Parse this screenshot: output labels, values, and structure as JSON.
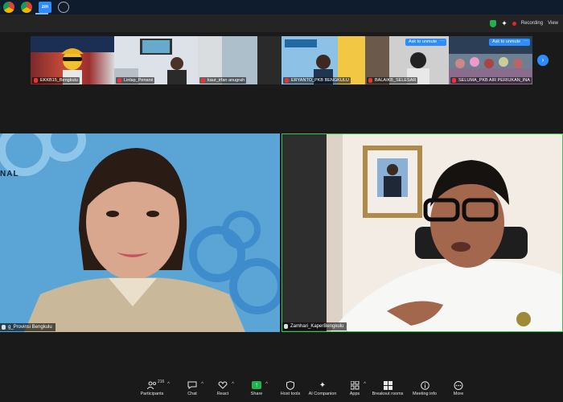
{
  "os_taskbar": {
    "apps": [
      {
        "icon": "chrome-icon"
      },
      {
        "icon": "chrome-icon"
      },
      {
        "icon": "zoom-app-icon",
        "label": "zm"
      },
      {
        "icon": "settings-app-icon"
      }
    ]
  },
  "title_bar": {
    "recording_label": "Recording",
    "view_label": "View"
  },
  "gallery": {
    "participants": [
      {
        "name": "EKKB15_Bengkulu"
      },
      {
        "name": "Linlap_Penarsi"
      },
      {
        "name": "kaur_irfan anugrah"
      },
      {
        "name": "ERYANTO_PKB BENGKULU"
      },
      {
        "name": "BALAIKB_SELESAR"
      },
      {
        "name": "SELUMA_PKB AIR PERIUKAN_INA"
      }
    ],
    "ask_to_unmute": "Ask to unmute",
    "more": "···",
    "next": "›"
  },
  "stage": {
    "left": {
      "name": "g_Provinsi Bengkulu",
      "bg_text": "NAL"
    },
    "right": {
      "name": "Zamhari_KaperBengkulu"
    }
  },
  "toolbar": {
    "participants_count": "216",
    "items": [
      {
        "label": "Participants",
        "icon": "participants-icon"
      },
      {
        "label": "Chat",
        "icon": "chat-icon"
      },
      {
        "label": "React",
        "icon": "react-heart-icon"
      },
      {
        "label": "Share",
        "icon": "share-screen-icon"
      },
      {
        "label": "Host tools",
        "icon": "shield-icon"
      },
      {
        "label": "AI Companion",
        "icon": "ai-sparkle-icon"
      },
      {
        "label": "Apps",
        "icon": "apps-icon"
      },
      {
        "label": "Breakout rooms",
        "icon": "breakout-rooms-icon"
      },
      {
        "label": "Meeting info",
        "icon": "info-icon"
      },
      {
        "label": "More",
        "icon": "more-icon"
      }
    ]
  },
  "colors": {
    "accent": "#2d8cff",
    "active_speaker": "#3ec14b",
    "recording": "#e02828"
  }
}
